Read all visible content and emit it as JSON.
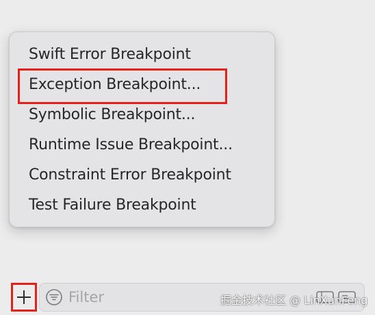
{
  "menu": {
    "items": [
      {
        "label": "Swift Error Breakpoint"
      },
      {
        "label": "Exception Breakpoint..."
      },
      {
        "label": "Symbolic Breakpoint..."
      },
      {
        "label": "Runtime Issue Breakpoint..."
      },
      {
        "label": "Constraint Error Breakpoint"
      },
      {
        "label": "Test Failure Breakpoint"
      }
    ],
    "highlighted_item_index": 1
  },
  "toolbar": {
    "add_button_icon": "plus-icon",
    "filter": {
      "icon": "filter-icon",
      "placeholder": "Filter",
      "value": ""
    },
    "scope_icons": [
      "scope-icon",
      "console-icon"
    ]
  },
  "watermark": {
    "text": "掘金技术社区 @ LinXunFeng"
  },
  "colors": {
    "highlight": "#e3201b",
    "menu_background": "#e4e4e6",
    "text": "#262628",
    "placeholder": "#a4a4a8"
  }
}
